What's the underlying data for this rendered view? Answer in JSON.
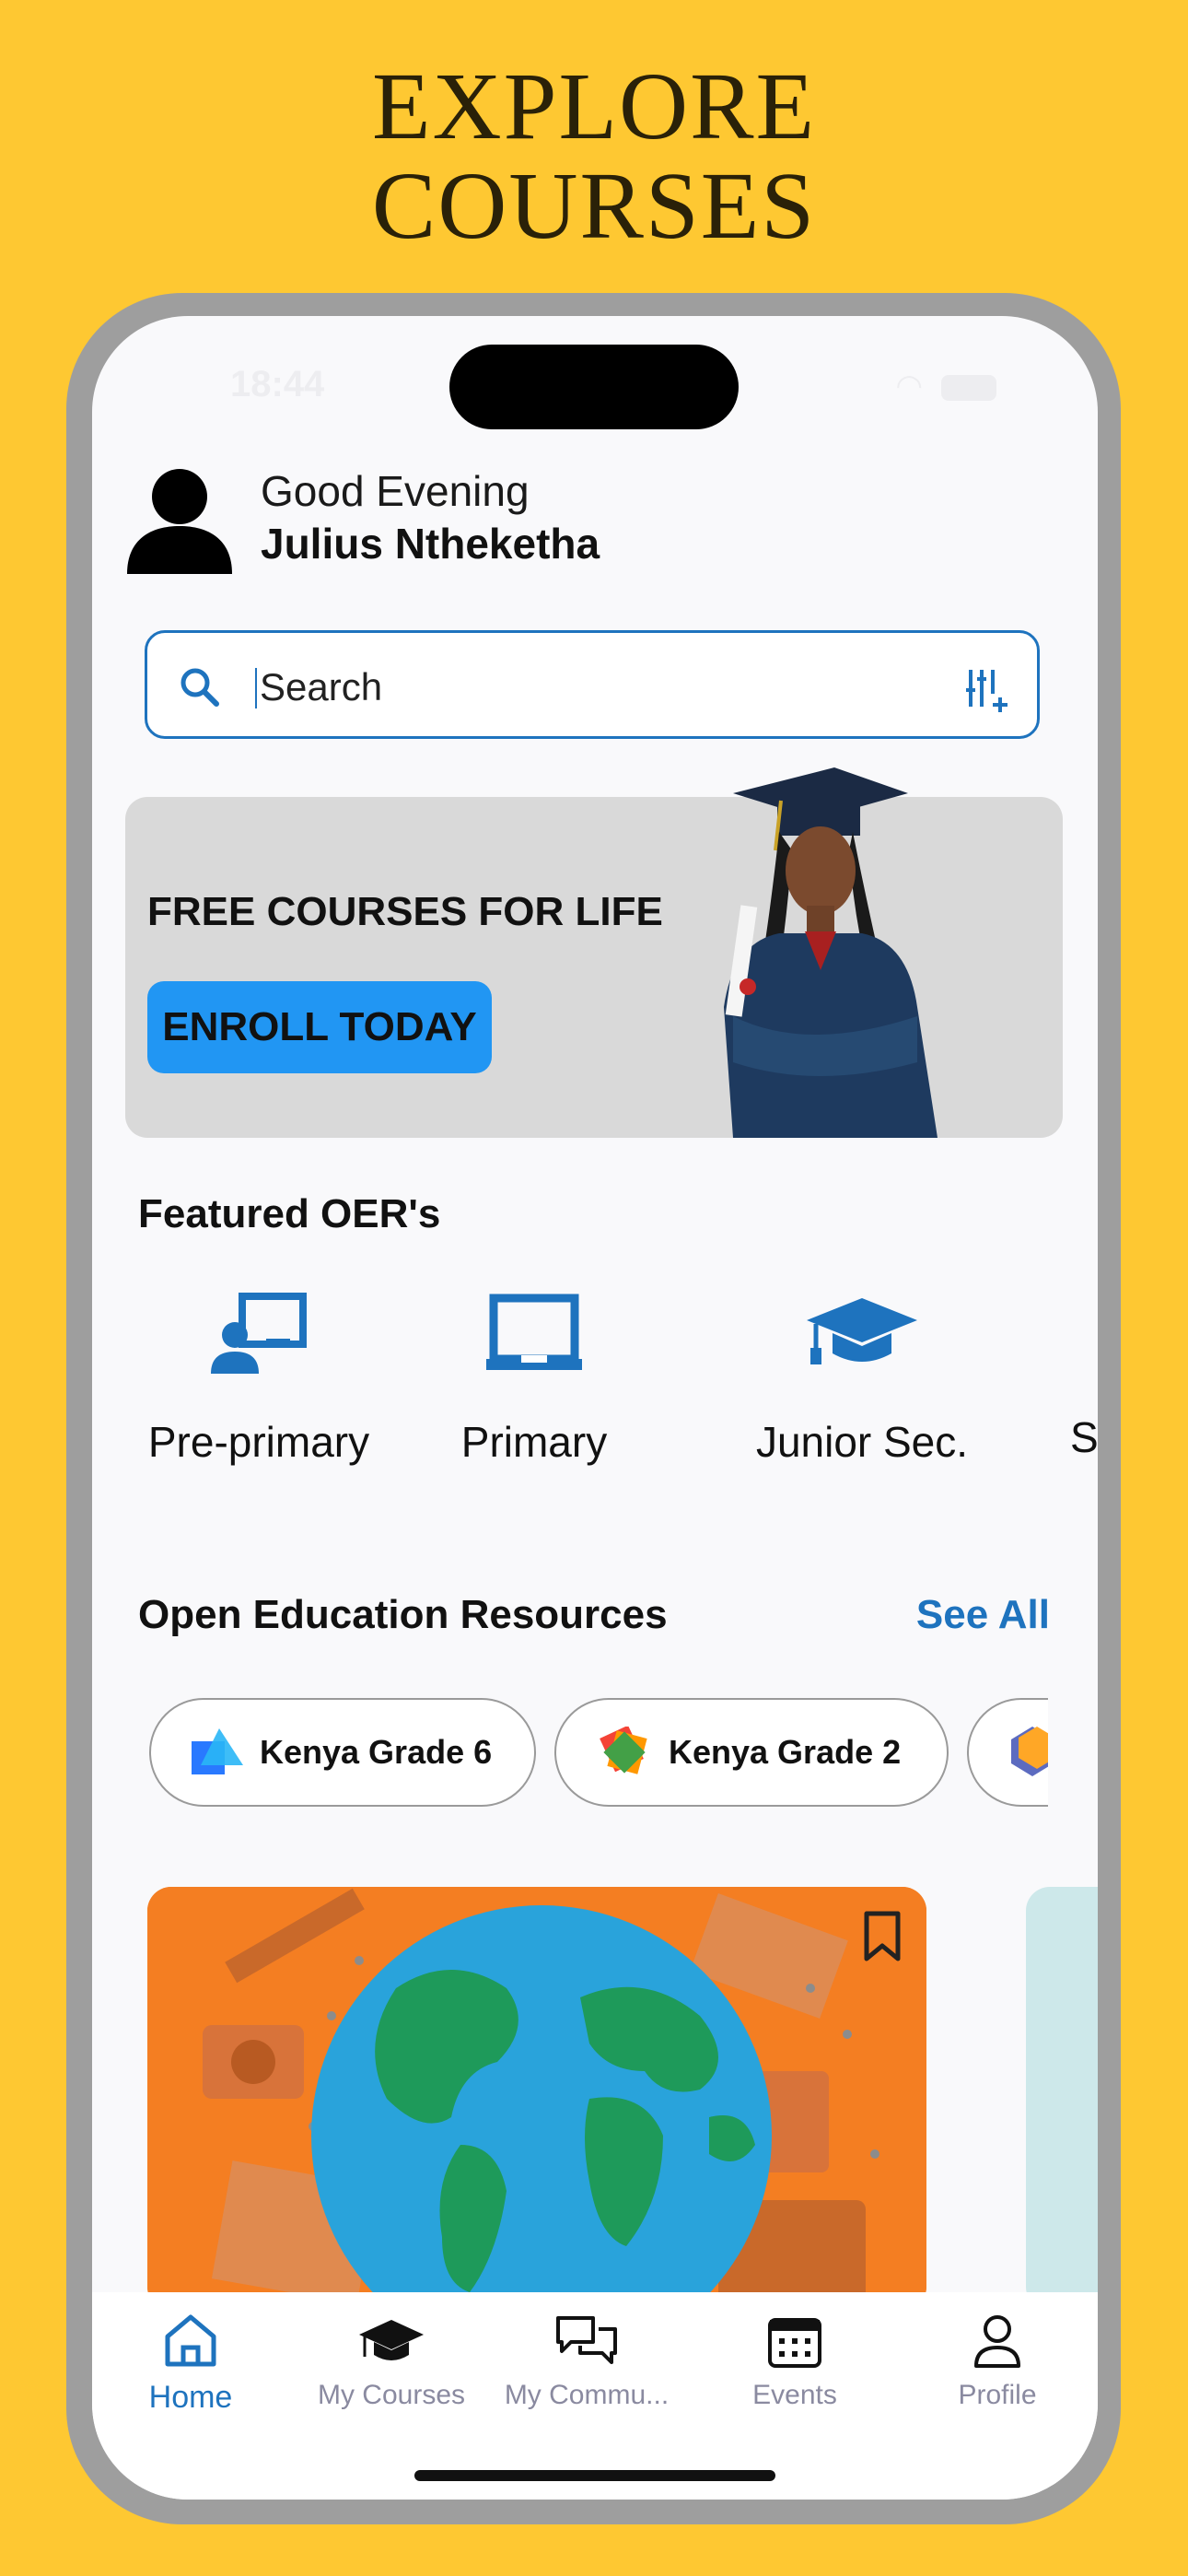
{
  "headline": [
    "EXPLORE",
    "COURSES"
  ],
  "status": {
    "time": "18:44"
  },
  "header": {
    "greeting": "Good Evening",
    "user_name": "Julius Ntheketha"
  },
  "search": {
    "placeholder": "Search"
  },
  "banner": {
    "title": "FREE COURSES FOR LIFE",
    "button": "ENROLL TODAY"
  },
  "featured": {
    "title": "Featured OER's",
    "items": [
      {
        "label": "Pre-primary",
        "icon": "teacher-board-icon"
      },
      {
        "label": "Primary",
        "icon": "laptop-icon"
      },
      {
        "label": "Junior Sec.",
        "icon": "graduation-cap-icon"
      },
      {
        "label": "S",
        "icon": ""
      }
    ]
  },
  "resources": {
    "title": "Open Education Resources",
    "see_all": "See All",
    "chips": [
      {
        "label": "Kenya Grade 6"
      },
      {
        "label": "Kenya Grade 2"
      }
    ]
  },
  "tabs": [
    {
      "label": "Home",
      "icon": "home-icon",
      "active": true
    },
    {
      "label": "My Courses",
      "icon": "graduation-cap-icon",
      "active": false
    },
    {
      "label": "My Commu...",
      "icon": "chat-bubbles-icon",
      "active": false
    },
    {
      "label": "Events",
      "icon": "calendar-icon",
      "active": false
    },
    {
      "label": "Profile",
      "icon": "person-icon",
      "active": false
    }
  ],
  "colors": {
    "background": "#FEC832",
    "accent": "#1E73BE",
    "enroll_button": "#2196F3",
    "card_orange": "#F47E22"
  }
}
